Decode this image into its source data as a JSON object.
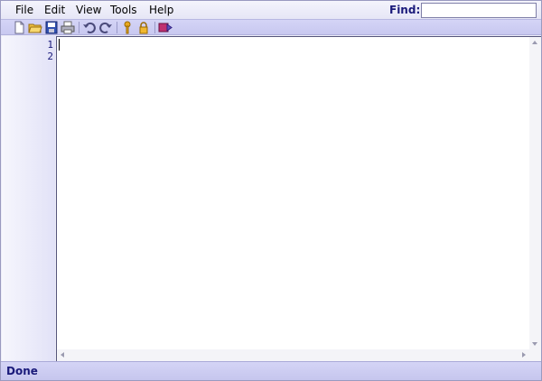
{
  "menubar": {
    "items": [
      {
        "label": "File"
      },
      {
        "label": "Edit"
      },
      {
        "label": "View"
      },
      {
        "label": "Tools"
      },
      {
        "label": "Help"
      }
    ],
    "find_label": "Find:",
    "find_value": ""
  },
  "toolbar": {
    "buttons": [
      "new-file-icon",
      "open-folder-icon",
      "save-icon",
      "print-icon",
      "undo-icon",
      "redo-icon",
      "key-icon",
      "lock-icon",
      "run-macro-icon"
    ]
  },
  "editor": {
    "line_numbers": [
      "1",
      "2"
    ],
    "content": ""
  },
  "statusbar": {
    "text": "Done"
  },
  "colors": {
    "accent": "#1a1a7a",
    "toolbar": "#cacaf2",
    "gutter": "#e8e8f8"
  }
}
